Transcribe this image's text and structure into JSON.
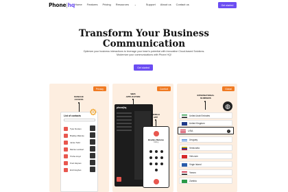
{
  "nav": {
    "logo_main": "Phone",
    "logo_sep": "|",
    "logo_accent": "hq",
    "items": [
      "Home",
      "Features",
      "Pricing",
      "Resources",
      "Support",
      "About us",
      "Contact us"
    ],
    "cta": "Get started"
  },
  "hero": {
    "title_line1": "Transform Your Business",
    "title_line2": "Communication",
    "subtitle": "Optimize your business interactions to leverage your team's potential with innovative Cloud-based Solutions. Modernize your communications with Phone HQ!",
    "cta": "Get started"
  },
  "cards": {
    "privacy": {
      "badge": "Privacy",
      "label": "MANAGE ACCESS",
      "panel_title": "List of contacts",
      "contacts": [
        "Tyler Durden",
        "Bradley Malonie",
        "Jamie Todd",
        "Marnie Lambert",
        "Trisha Lloyd",
        "Fred Haynes",
        "Emil Hughes"
      ]
    },
    "comfort": {
      "badge": "Comfort",
      "label_web": "WEB APPLICATION",
      "label_mobile": "MOBILE APP",
      "app_logo": "phone|hq",
      "caller_name": "Bradley Malonie",
      "caller_sub": "Calling"
    },
    "global": {
      "badge": "Global",
      "label": "INTERNATIONAL NUMBERS",
      "countries": [
        "United Arab Emirates",
        "United Kingdom",
        "USA",
        "Uruguay",
        "Venezuela",
        "Viet-nam",
        "Virgin Island",
        "Yemen",
        "Zambia"
      ],
      "selected": "USA"
    }
  },
  "colors": {
    "accent": "#6b4df2",
    "orange": "#f07a22",
    "card_bg": "#fdeee0",
    "avatar_red": "#e8574f"
  }
}
